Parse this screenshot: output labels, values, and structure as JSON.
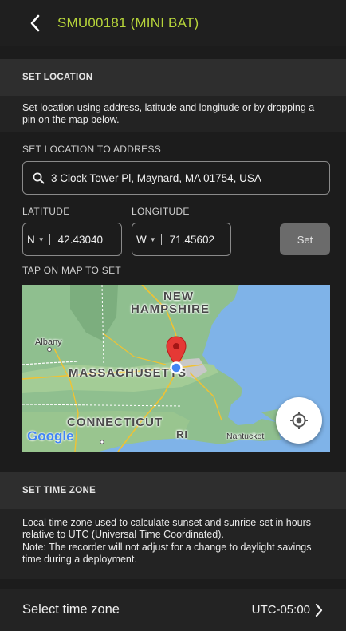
{
  "header": {
    "title": "SMU00181 (MINI BAT)"
  },
  "location": {
    "section_title": "SET LOCATION",
    "description": "Set location using address, latitude and longitude or by dropping a pin on the map below.",
    "address_label": "SET LOCATION TO ADDRESS",
    "address_value": "3 Clock Tower Pl, Maynard, MA 01754, USA",
    "latitude_label": "LATITUDE",
    "latitude_dir": "N",
    "latitude_value": "42.43040",
    "longitude_label": "LONGITUDE",
    "longitude_dir": "W",
    "longitude_value": "71.45602",
    "set_label": "Set",
    "map_label": "TAP ON MAP TO SET",
    "map": {
      "new_hampshire": [
        "NEW",
        "HAMPSHIRE"
      ],
      "massachusetts": "MASSACHUSETTS",
      "connecticut": "CONNECTICUT",
      "ri": "RI",
      "albany": "Albany",
      "nantucket": "Nantucket",
      "attribution": "Google"
    }
  },
  "timezone": {
    "section_title": "SET TIME ZONE",
    "description": "Local time zone used to calculate sunset and sunrise-set in hours relative to UTC (Universal Time Coordinated).",
    "note": "Note: The recorder will not adjust for a change to daylight savings time during a deployment.",
    "select_label": "Select time zone",
    "value": "UTC-05:00"
  },
  "colors": {
    "accent": "#b6d43a",
    "pin": "#e53935",
    "user_dot": "#4285f4"
  }
}
